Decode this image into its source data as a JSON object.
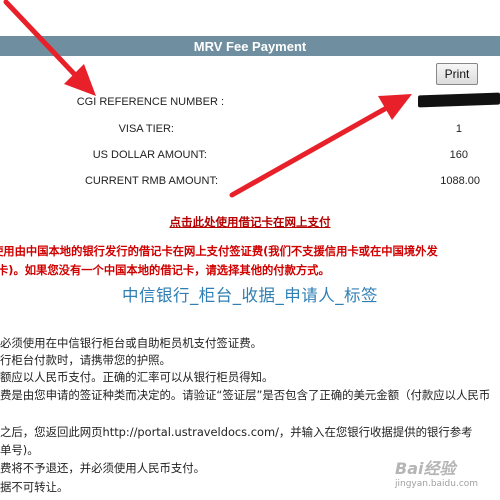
{
  "header": {
    "title": "MRV Fee Payment"
  },
  "print_button": {
    "label": "Print"
  },
  "fields": {
    "cgi_reference": {
      "label": "CGI REFERENCE NUMBER :",
      "value": ""
    },
    "visa_tier": {
      "label": "VISA TIER:",
      "value": "1"
    },
    "usd_amount": {
      "label": "US DOLLAR AMOUNT:",
      "value": "160"
    },
    "rmb_amount": {
      "label": "CURRENT RMB AMOUNT:",
      "value": "1088.00"
    }
  },
  "pay_link": {
    "label": "点击此处使用借记卡在网上支付"
  },
  "notice": {
    "line1": "使用由中国本地的银行发行的借记卡在网上支付签证费(我们不支援信用卡或在中国境外发",
    "line2": "卡)。如果您没有一个中国本地的借记卡，请选择其他的付款方式。"
  },
  "bank_section": {
    "title": "中信银行_柜台_收据_申请人_标签"
  },
  "instructions": [
    "必须使用在中信银行柜台或自助柜员机支付签证费。",
    "行柜台付款时，请携带您的护照。",
    "额应以人民币支付。正确的汇率可以从银行柜员得知。",
    "费是由您申请的签证种类而决定的。请验证“签证层”是否包含了正确的美元金额（付款应以人民币",
    "",
    "之后，您返回此网页http://portal.ustraveldocs.com/，并输入在您银行收据提供的银行参考",
    "单号)。",
    "费将不予退还，并必须使用人民币支付。",
    "据不可转让。"
  ],
  "watermark": {
    "text": "Bai经验",
    "subtext": "jingyan.baidu.com"
  },
  "colors": {
    "header_bg": "#6f8fa0",
    "arrow": "#e8202a",
    "notice_red": "#d00000",
    "bank_blue": "#2f7fb4"
  }
}
